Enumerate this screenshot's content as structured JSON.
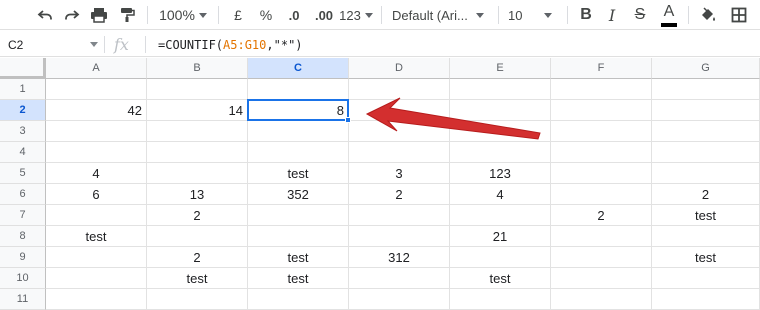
{
  "toolbar": {
    "zoom": "100%",
    "currency": "£",
    "percent": "%",
    "decrease_decimal": ".0",
    "increase_decimal": ".00",
    "more_formats": "123",
    "font_family": "Default (Ari...",
    "font_size": "10",
    "bold": "B",
    "italic": "I",
    "strikethrough": "S",
    "text_color_label": "A",
    "text_color": "#000000"
  },
  "formula_bar": {
    "name_box": "C2",
    "fx": "fx",
    "formula_prefix": "=COUNTIF(",
    "formula_range": "A5:G10",
    "formula_suffix": ",\"*\")"
  },
  "sheet": {
    "columns": [
      "A",
      "B",
      "C",
      "D",
      "E",
      "F",
      "G"
    ],
    "rows": [
      "1",
      "2",
      "3",
      "4",
      "5",
      "6",
      "7",
      "8",
      "9",
      "10",
      "11"
    ],
    "selected_cell": "C2",
    "cells": {
      "A2": "42",
      "B2": "14",
      "C2": "8",
      "A5": "4",
      "C5": "test",
      "D5": "3",
      "E5": "123",
      "A6": "6",
      "B6": "13",
      "C6": "352",
      "D6": "2",
      "E6": "4",
      "G6": "2",
      "B7": "2",
      "F7": "2",
      "G7": "test",
      "A8": "test",
      "E8": "21",
      "B9": "2",
      "C9": "test",
      "D9": "312",
      "G9": "test",
      "B10": "test",
      "C10": "test",
      "E10": "test"
    }
  },
  "colors": {
    "selection": "#1a73e8",
    "header_selected_bg": "#d3e3fd",
    "arrow": "#d32f2f",
    "formula_range": "#e37400"
  }
}
